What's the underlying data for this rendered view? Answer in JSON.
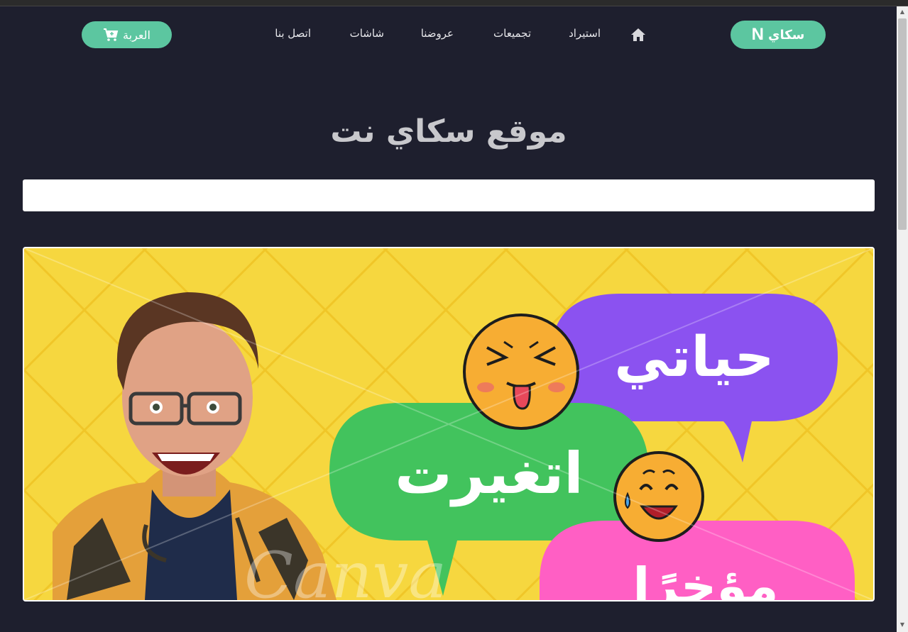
{
  "brand": {
    "name": "سكاي",
    "letter": "N",
    "color": "#5cc6a0"
  },
  "nav": {
    "home_icon": "home-icon",
    "items": [
      {
        "label": "استيراد"
      },
      {
        "label": "تجميعات"
      },
      {
        "label": "عروضنا"
      },
      {
        "label": "شاشات"
      },
      {
        "label": "اتصل بنا"
      }
    ],
    "cart_label": "العربة",
    "cart_icon": "cart-plus-icon"
  },
  "hero": {
    "title": "موقع سكاي نت"
  },
  "search": {
    "value": "",
    "placeholder": ""
  },
  "banner": {
    "bubble_purple_text": "حياتي",
    "bubble_green_text": "اتغيرت",
    "bubble_pink_text": "مؤخرًا",
    "watermark": "Canva",
    "colors": {
      "background": "#f6d73f",
      "purple": "#8b52f0",
      "green": "#42c35d",
      "pink": "#ff5fc4",
      "emoji": "#f7ad33"
    }
  }
}
